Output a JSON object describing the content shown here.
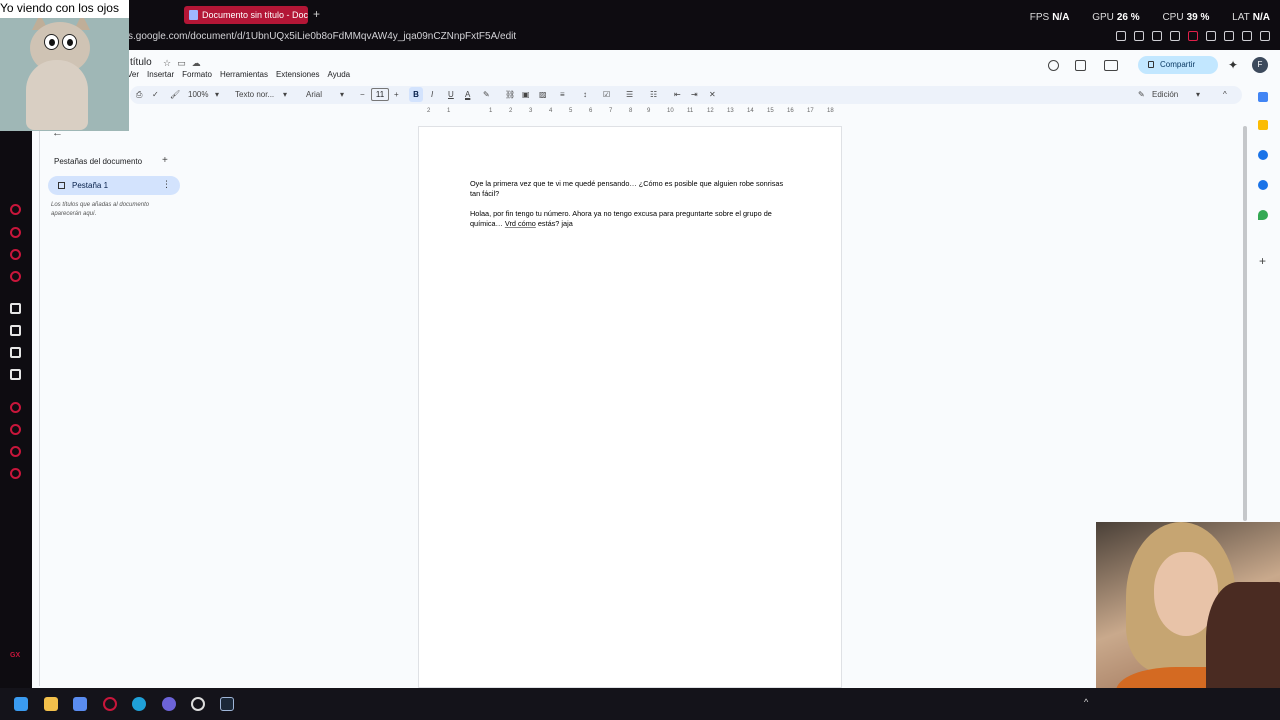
{
  "browser": {
    "tab_title": "Documento sin título - Doc",
    "url": "s.google.com/document/d/1UbnUQx5iLie0b8oFdMMqvAW4y_jqa09nCZNnpFxtF5A/edit",
    "stats": {
      "fps_label": "FPS",
      "fps_value": "N/A",
      "gpu_label": "GPU",
      "gpu_value": "26 %",
      "cpu_label": "CPU",
      "cpu_value": "39 %",
      "lat_label": "LAT",
      "lat_value": "N/A"
    },
    "ai_label": "AI"
  },
  "docs": {
    "title": "título",
    "menu": [
      "Ver",
      "Insertar",
      "Formato",
      "Herramientas",
      "Extensiones",
      "Ayuda"
    ],
    "share_label": "Compartir",
    "avatar_letter": "F",
    "toolbar": {
      "zoom": "100%",
      "style": "Texto nor...",
      "font": "Arial",
      "font_size": "11",
      "bold": "B",
      "italic": "I",
      "underline": "U",
      "text_color": "A",
      "mode": "Edición"
    },
    "ruler_ticks": [
      "2",
      "1",
      "1",
      "2",
      "3",
      "4",
      "5",
      "6",
      "7",
      "8",
      "9",
      "10",
      "11",
      "12",
      "13",
      "14",
      "15",
      "16",
      "17",
      "18"
    ],
    "tabs_panel": {
      "title": "Pestañas del documento",
      "tab_label": "Pestaña 1",
      "hint": "Los títulos que añadas al documento aparecerán aquí."
    },
    "content": {
      "para1": "Oye la primera vez que te vi me quedé pensando… ¿Cómo es posible que alguien robe sonrisas tan fácil?",
      "para2_start": "Holaa, por fin tengo tu número. Ahora ya no tengo excusa para preguntarte sobre el grupo de química… ",
      "para2_underlined": "Vrd cómo",
      "para2_end": " estás? jaja"
    }
  },
  "overlay": {
    "caption": "Yo viendo con los ojos"
  },
  "colors": {
    "tab_active": "#b31636",
    "accent": "#c8163b",
    "share_bg": "#c2e7ff",
    "toolbar_bg": "#edf2fa"
  }
}
